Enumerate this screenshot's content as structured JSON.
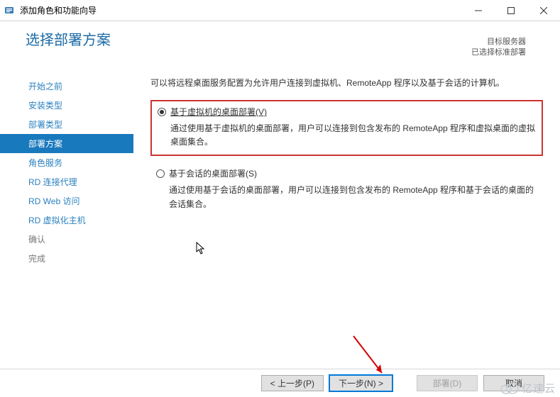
{
  "window": {
    "title": "添加角色和功能向导"
  },
  "header": {
    "page_title": "选择部署方案",
    "target_label": "目标服务器",
    "target_value": "已选择标准部署"
  },
  "sidebar": {
    "items": [
      {
        "label": "开始之前",
        "state": "enabled"
      },
      {
        "label": "安装类型",
        "state": "enabled"
      },
      {
        "label": "部署类型",
        "state": "enabled"
      },
      {
        "label": "部署方案",
        "state": "active"
      },
      {
        "label": "角色服务",
        "state": "enabled"
      },
      {
        "label": "RD 连接代理",
        "state": "enabled"
      },
      {
        "label": "RD Web 访问",
        "state": "enabled"
      },
      {
        "label": "RD 虚拟化主机",
        "state": "enabled"
      },
      {
        "label": "确认",
        "state": "disabled"
      },
      {
        "label": "完成",
        "state": "disabled"
      }
    ]
  },
  "main": {
    "intro": "可以将远程桌面服务配置为允许用户连接到虚拟机、RemoteApp 程序以及基于会话的计算机。",
    "options": [
      {
        "label": "基于虚拟机的桌面部署(V)",
        "checked": true,
        "highlighted": true,
        "desc": "通过使用基于虚拟机的桌面部署，用户可以连接到包含发布的 RemoteApp 程序和虚拟桌面的虚拟桌面集合。"
      },
      {
        "label": "基于会话的桌面部署(S)",
        "checked": false,
        "highlighted": false,
        "desc": "通过使用基于会话的桌面部署，用户可以连接到包含发布的 RemoteApp 程序和基于会话的桌面的会话集合。"
      }
    ]
  },
  "footer": {
    "prev": "< 上一步(P)",
    "next": "下一步(N) >",
    "deploy": "部署(D)",
    "cancel": "取消"
  },
  "watermark": "亿速云"
}
